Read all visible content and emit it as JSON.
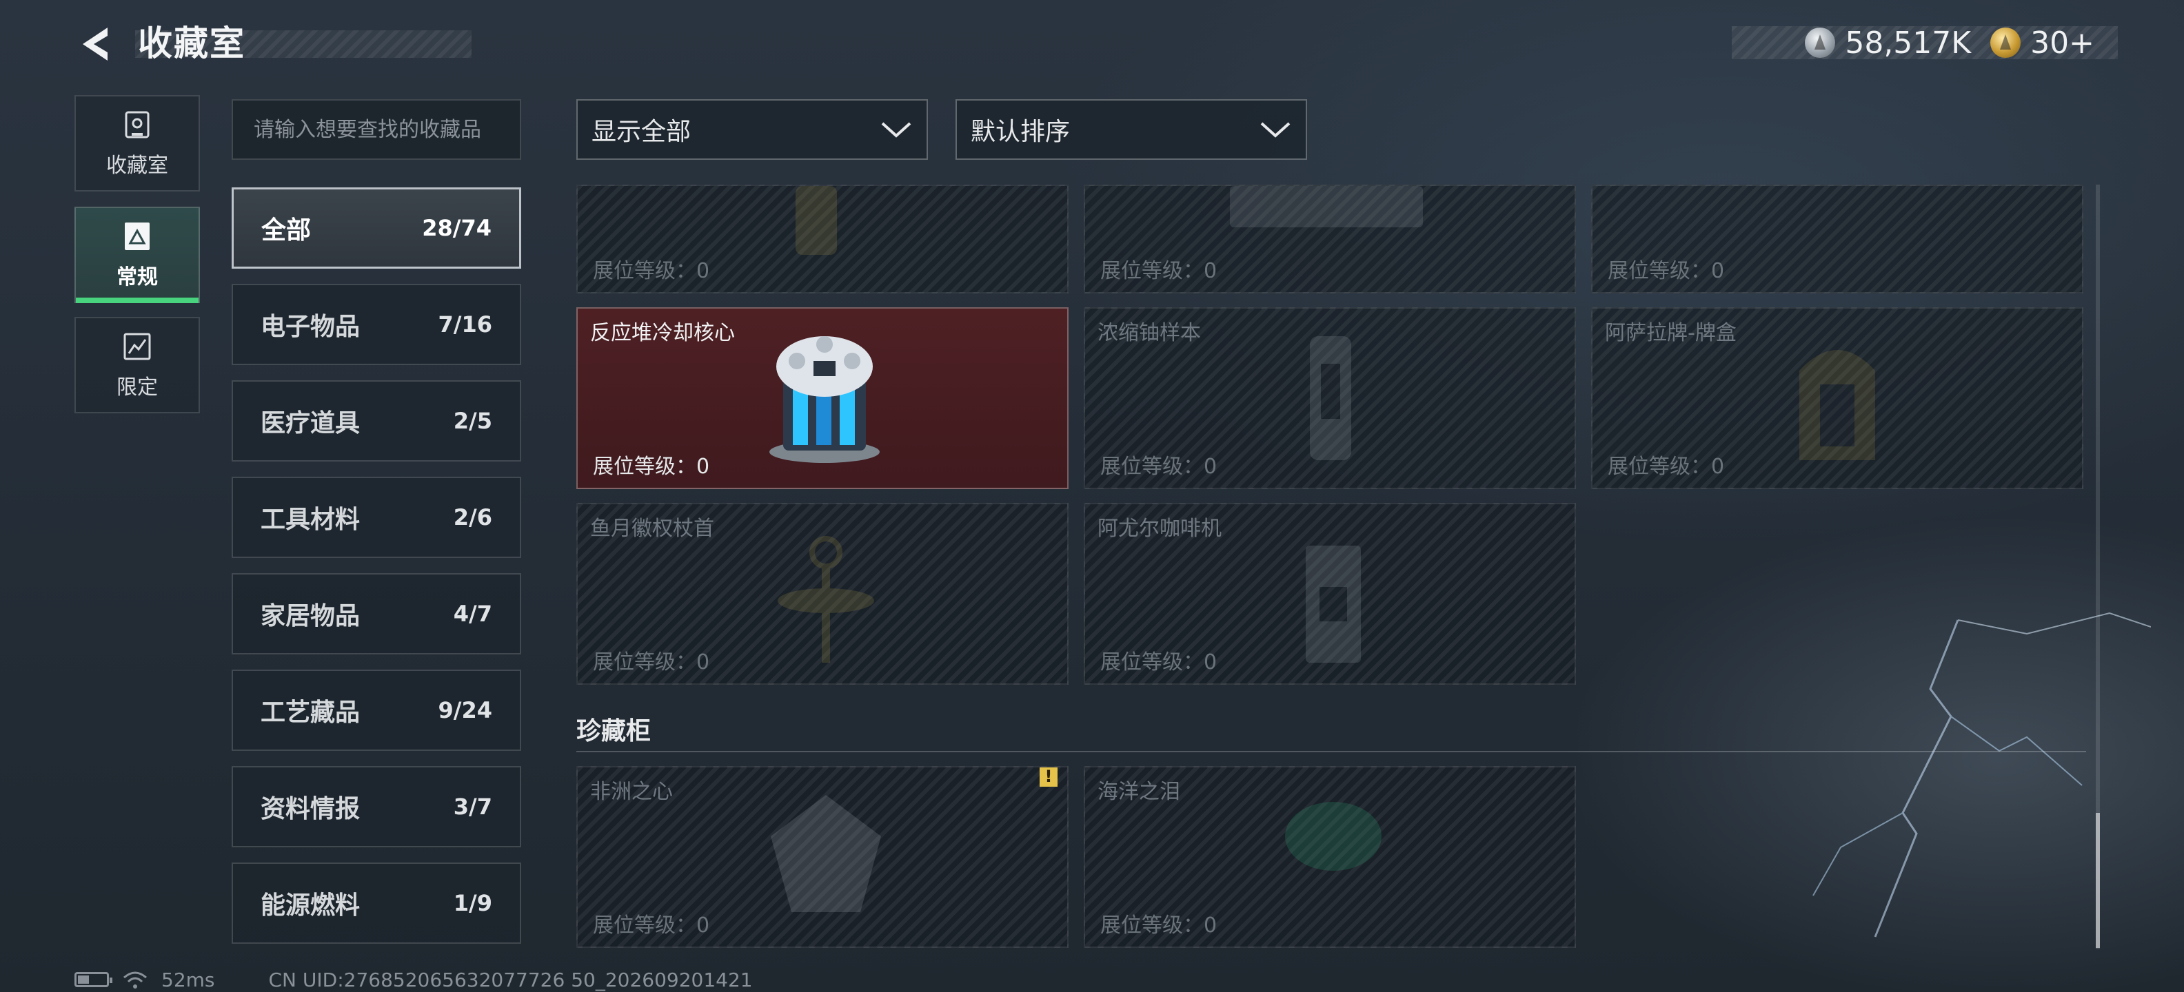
{
  "header": {
    "title": "收藏室",
    "back_icon": "back-arrow-icon"
  },
  "currency": [
    {
      "icon": "silver-coin-icon",
      "value": "58,517K"
    },
    {
      "icon": "gold-coin-icon",
      "value": "30+"
    }
  ],
  "left_tabs": [
    {
      "label": "收藏室",
      "icon": "collection-room-icon",
      "active": false
    },
    {
      "label": "常规",
      "icon": "regular-icon",
      "active": true
    },
    {
      "label": "限定",
      "icon": "limited-icon",
      "active": false
    }
  ],
  "search": {
    "placeholder": "请输入想要查找的收藏品",
    "value": ""
  },
  "categories": [
    {
      "name": "全部",
      "count": "28/74",
      "active": true
    },
    {
      "name": "电子物品",
      "count": "7/16"
    },
    {
      "name": "医疗道具",
      "count": "2/5"
    },
    {
      "name": "工具材料",
      "count": "2/6"
    },
    {
      "name": "家居物品",
      "count": "4/7"
    },
    {
      "name": "工艺藏品",
      "count": "9/24"
    },
    {
      "name": "资料情报",
      "count": "3/7"
    },
    {
      "name": "能源燃料",
      "count": "1/9"
    }
  ],
  "filters": {
    "show": {
      "value": "显示全部"
    },
    "sort": {
      "value": "默认排序"
    }
  },
  "level_label": "展位等级：0",
  "items_partial": [
    {
      "name": ""
    },
    {
      "name": ""
    },
    {
      "name": ""
    }
  ],
  "items": [
    {
      "name": "反应堆冷却核心",
      "selected": true
    },
    {
      "name": "浓缩铀样本"
    },
    {
      "name": "阿萨拉牌-牌盒"
    },
    {
      "name": "鱼月徽权杖首"
    },
    {
      "name": "阿尤尔咖啡机"
    }
  ],
  "section": {
    "title": "珍藏柜"
  },
  "showcase_items": [
    {
      "name": "非洲之心",
      "warning": "!"
    },
    {
      "name": "海洋之泪"
    }
  ],
  "status_bar": {
    "ping": "52ms",
    "uid": "CN UID:276852065632077726 50_202609201421"
  },
  "colors": {
    "accent_green": "#48d47e",
    "selected_card": "#4e2024",
    "warning": "#e5c24a"
  }
}
